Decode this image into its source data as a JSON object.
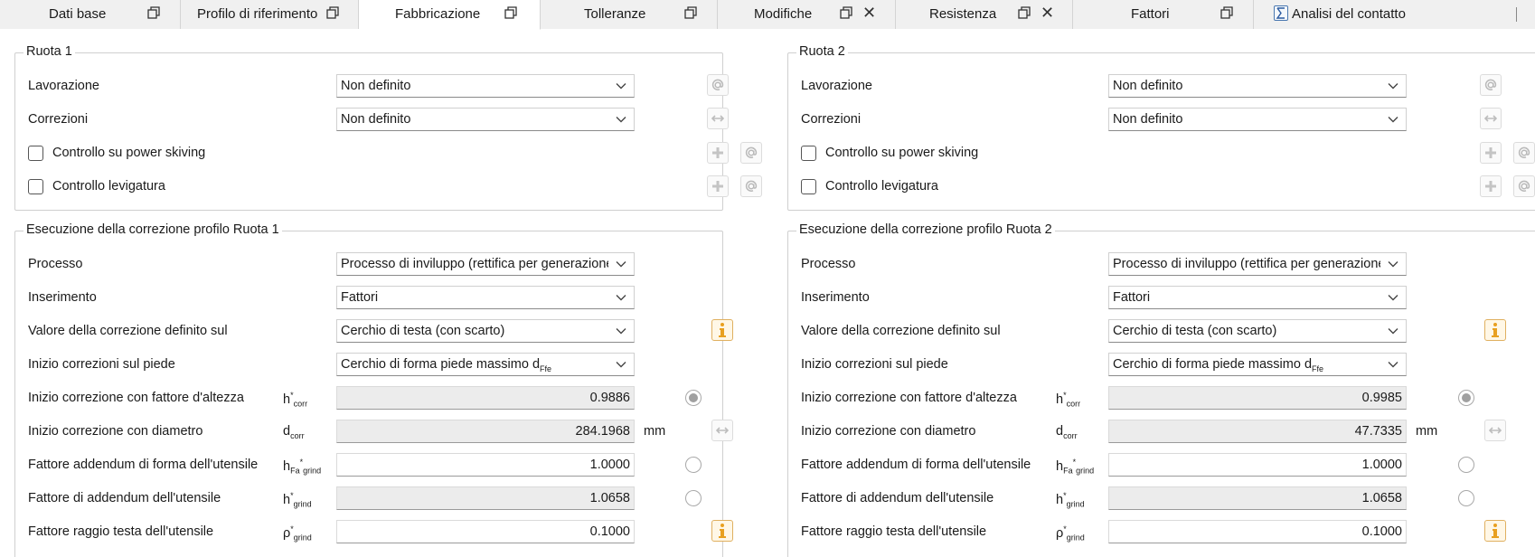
{
  "tabs": [
    {
      "label": "Dati base",
      "icon": "window-restore-icon",
      "closable": false
    },
    {
      "label": "Profilo di riferimento",
      "icon": "window-restore-icon",
      "closable": false
    },
    {
      "label": "Fabbricazione",
      "icon": "window-restore-icon",
      "closable": false,
      "active": true
    },
    {
      "label": "Tolleranze",
      "icon": "window-restore-icon",
      "closable": false
    },
    {
      "label": "Modifiche",
      "icon": "window-restore-icon",
      "closable": true
    },
    {
      "label": "Resistenza",
      "icon": "window-restore-icon",
      "closable": true
    },
    {
      "label": "Fattori",
      "icon": "window-restore-icon",
      "closable": false
    },
    {
      "label": "Analisi del contatto",
      "icon": "sigma-calculator-icon",
      "closable": false
    }
  ],
  "close_glyph": "✕",
  "gear1": {
    "title": "Ruota 1",
    "lavorazione_label": "Lavorazione",
    "lavorazione_value": "Non definito",
    "correzioni_label": "Correzioni",
    "correzioni_value": "Non definito",
    "power_skiving_label": "Controllo su power skiving",
    "levigatura_label": "Controllo levigatura"
  },
  "gear2": {
    "title": "Ruota 2",
    "lavorazione_label": "Lavorazione",
    "lavorazione_value": "Non definito",
    "correzioni_label": "Correzioni",
    "correzioni_value": "Non definito",
    "power_skiving_label": "Controllo su power skiving",
    "levigatura_label": "Controllo levigatura"
  },
  "corr1": {
    "title": "Esecuzione della correzione profilo Ruota 1",
    "processo_label": "Processo",
    "processo_value": "Processo di inviluppo (rettifica per generazione)",
    "inserimento_label": "Inserimento",
    "inserimento_value": "Fattori",
    "valore_label": "Valore della correzione definito sul",
    "valore_value": "Cerchio di testa (con scarto)",
    "inizio_piede_label": "Inizio correzioni sul piede",
    "inizio_piede_value": "Cerchio di forma piede massimo d",
    "inizio_piede_sub": "Ffe",
    "hcorr_label": "Inizio correzione con fattore d'altezza",
    "hcorr_value": "0.9886",
    "dcorr_label": "Inizio correzione con diametro",
    "dcorr_value": "284.1968",
    "dcorr_unit": "mm",
    "hfa_label": "Fattore addendum di forma dell'utensile",
    "hfa_value": "1.0000",
    "hgrind_label": "Fattore di addendum dell'utensile",
    "hgrind_value": "1.0658",
    "rho_label": "Fattore raggio testa dell'utensile",
    "rho_value": "0.1000"
  },
  "corr2": {
    "title": "Esecuzione della correzione profilo Ruota 2",
    "processo_label": "Processo",
    "processo_value": "Processo di inviluppo (rettifica per generazione)",
    "inserimento_label": "Inserimento",
    "inserimento_value": "Fattori",
    "valore_label": "Valore della correzione definito sul",
    "valore_value": "Cerchio di testa (con scarto)",
    "inizio_piede_label": "Inizio correzioni sul piede",
    "inizio_piede_value": "Cerchio di forma piede massimo d",
    "inizio_piede_sub": "Ffe",
    "hcorr_label": "Inizio correzione con fattore d'altezza",
    "hcorr_value": "0.9985",
    "dcorr_label": "Inizio correzione con diametro",
    "dcorr_value": "47.7335",
    "dcorr_unit": "mm",
    "hfa_label": "Fattore addendum di forma dell'utensile",
    "hfa_value": "1.0000",
    "hgrind_label": "Fattore di addendum dell'utensile",
    "hgrind_value": "1.0658",
    "rho_label": "Fattore raggio testa dell'utensile",
    "rho_value": "0.1000"
  },
  "symbols": {
    "h": "h",
    "d": "d",
    "rho": "ρ",
    "star": "*",
    "corr": "corr",
    "fa": "Fa",
    "grind": "grind"
  },
  "colors": {
    "tab_bg": "#f0f0f0",
    "active_tab_bg": "#ffffff",
    "readonly_field": "#ececec",
    "info_accent": "#e8a020"
  }
}
